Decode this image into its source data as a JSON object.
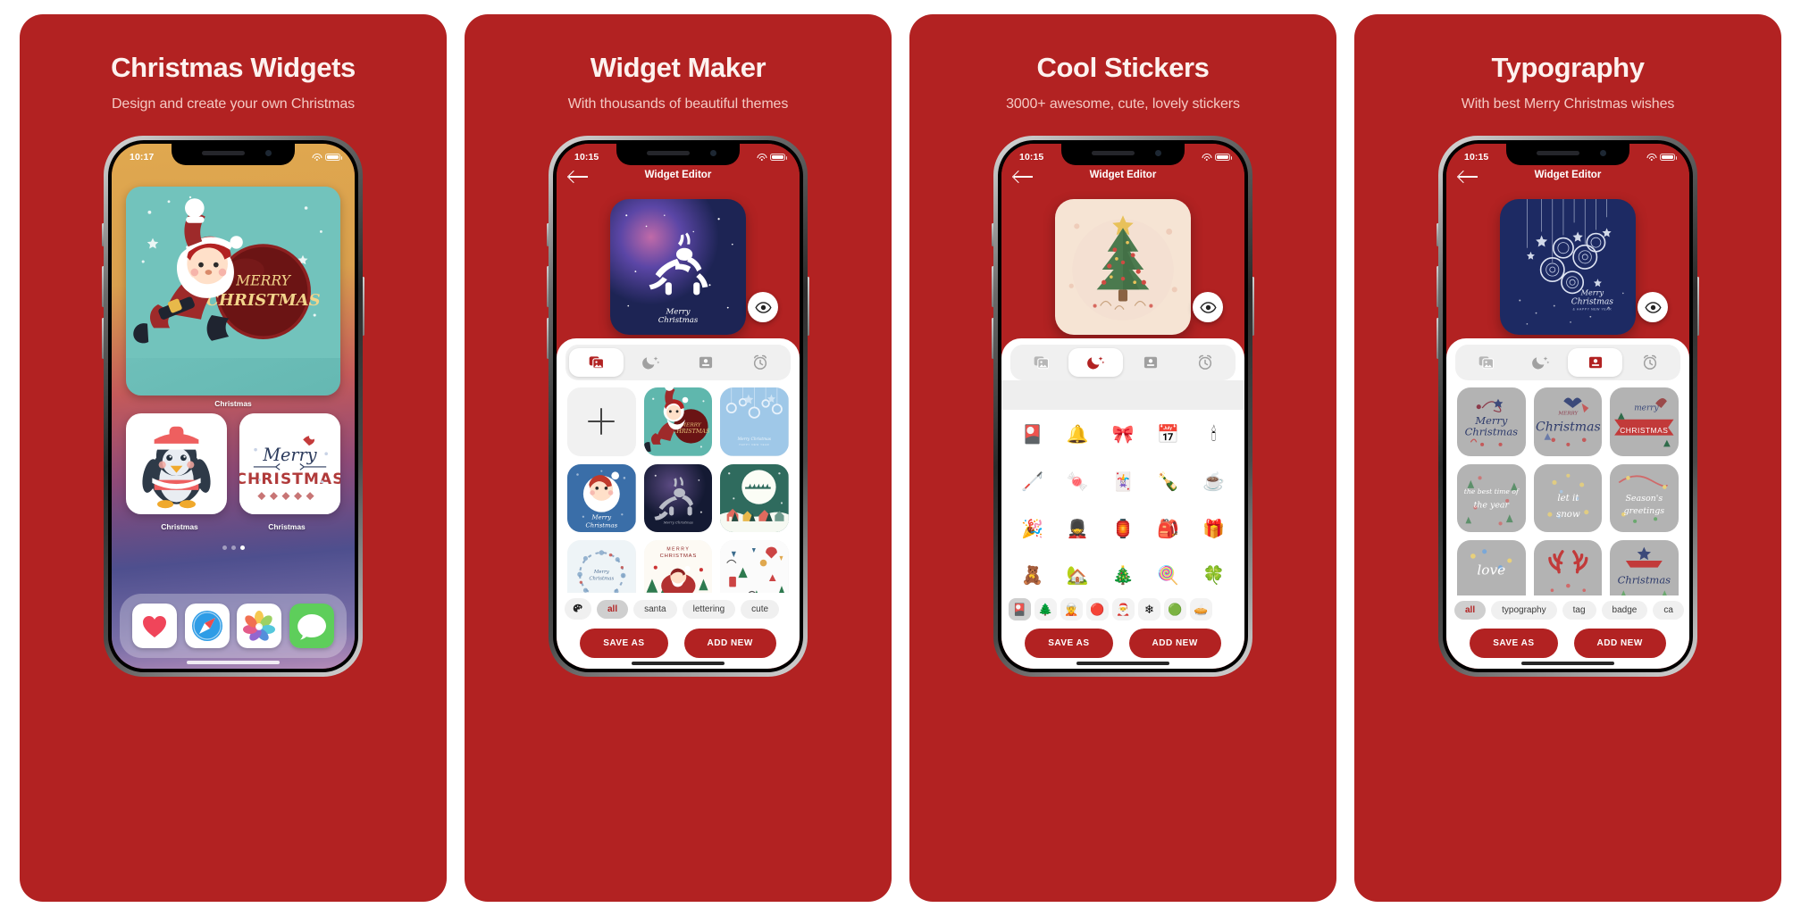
{
  "brand": {
    "red": "#b22222",
    "white": "#ffffff",
    "subtitle_color": "#f4c9c3"
  },
  "panels": [
    {
      "id": "christmas-widgets",
      "title": "Christmas Widgets",
      "subtitle": "Design and create your own Christmas",
      "screen_type": "home",
      "status_bar": {
        "time": "10:17",
        "wifi": "wifi-icon",
        "battery": "battery-icon"
      },
      "home": {
        "large_widget": {
          "caption": "Christmas",
          "art": "santa-merry-christmas"
        },
        "small_widgets": [
          {
            "caption": "Christmas",
            "art": "penguin"
          },
          {
            "caption": "Christmas",
            "art": "merry-christmas-lettering"
          }
        ],
        "page_dots": {
          "count": 3,
          "active_index": 2
        },
        "dock": [
          {
            "name": "health-app-icon",
            "label": "Health"
          },
          {
            "name": "safari-app-icon",
            "label": "Safari"
          },
          {
            "name": "photos-app-icon",
            "label": "Photos"
          },
          {
            "name": "messages-app-icon",
            "label": "Messages"
          }
        ]
      }
    },
    {
      "id": "widget-maker",
      "title": "Widget Maker",
      "subtitle": "With thousands of beautiful themes",
      "screen_type": "editor",
      "status_bar": {
        "time": "10:15",
        "wifi": "wifi-icon",
        "battery": "battery-icon"
      },
      "nav": {
        "back": "back-arrow-icon",
        "title": "Widget Editor"
      },
      "preview": {
        "art": "reindeer-galaxy",
        "caption": "Merry Christmas",
        "eye_button": "eye-icon"
      },
      "tabs": [
        {
          "name": "tab-backgrounds",
          "icon": "photos-stack-icon",
          "active": true
        },
        {
          "name": "tab-night",
          "icon": "moon-stars-icon",
          "active": false
        },
        {
          "name": "tab-card",
          "icon": "card-icon",
          "active": false
        },
        {
          "name": "tab-alarm",
          "icon": "alarm-clock-icon",
          "active": false
        }
      ],
      "grid_type": "themes",
      "themes": [
        {
          "label": "Add new",
          "art": "plus"
        },
        {
          "label": "Santa Merry Christmas",
          "art": "santa-teal"
        },
        {
          "label": "Blue baubles",
          "art": "blue-baubles"
        },
        {
          "label": "Santa Merry Christmas blue",
          "art": "santa-blue"
        },
        {
          "label": "Reindeer night",
          "art": "reindeer-dark"
        },
        {
          "label": "Sleigh moon village",
          "art": "sleigh-village"
        },
        {
          "label": "Merry Christmas wreath",
          "art": "wreath-light"
        },
        {
          "label": "Merry Christmas red",
          "art": "santa-sleigh-red"
        },
        {
          "label": "Winter doodles",
          "art": "doodles"
        }
      ],
      "filters": [
        {
          "label": "palette-icon",
          "type": "icon",
          "active": false
        },
        {
          "label": "all",
          "type": "text",
          "active": true
        },
        {
          "label": "santa",
          "type": "text",
          "active": false
        },
        {
          "label": "lettering",
          "type": "text",
          "active": false
        },
        {
          "label": "cute",
          "type": "text",
          "active": false
        }
      ],
      "actions": {
        "save": "SAVE AS",
        "add": "ADD NEW"
      }
    },
    {
      "id": "cool-stickers",
      "title": "Cool Stickers",
      "subtitle": "3000+ awesome, cute, lovely stickers",
      "screen_type": "editor",
      "status_bar": {
        "time": "10:15",
        "wifi": "wifi-icon",
        "battery": "battery-icon"
      },
      "nav": {
        "back": "back-arrow-icon",
        "title": "Widget Editor"
      },
      "preview": {
        "art": "christmas-tree-cream",
        "eye_button": "eye-icon"
      },
      "tabs": [
        {
          "name": "tab-backgrounds",
          "icon": "photos-stack-icon",
          "active": false
        },
        {
          "name": "tab-night",
          "icon": "moon-stars-icon",
          "active": true
        },
        {
          "name": "tab-card",
          "icon": "card-icon",
          "active": false
        },
        {
          "name": "tab-alarm",
          "icon": "alarm-clock-icon",
          "active": false
        }
      ],
      "grid_type": "stickers",
      "stickers": [
        "ornament-ball",
        "christmas-bell",
        "red-bow",
        "calendar-25",
        "candle",
        "candy-cane",
        "christmas-cracker",
        "greeting-card",
        "champagne-glasses",
        "hot-cocoa-mug",
        "party-popper",
        "nutcrackers",
        "fireplace",
        "gift-sack",
        "gift-box",
        "gingerbread-man",
        "snow-house-tree",
        "snowy-tree",
        "lollipop-candy",
        "holly-wreath"
      ],
      "categories": [
        {
          "name": "cat-ornament",
          "icon": "ornament",
          "active": true
        },
        {
          "name": "cat-tree",
          "icon": "tree",
          "active": false
        },
        {
          "name": "cat-elf",
          "icon": "elf",
          "active": false
        },
        {
          "name": "cat-bauble",
          "icon": "bauble",
          "active": false
        },
        {
          "name": "cat-santa",
          "icon": "santa",
          "active": false
        },
        {
          "name": "cat-snowflake",
          "icon": "snowflake",
          "active": false
        },
        {
          "name": "cat-wreath",
          "icon": "wreath",
          "active": false
        },
        {
          "name": "cat-more",
          "icon": "more",
          "active": false
        }
      ],
      "actions": {
        "save": "SAVE AS",
        "add": "ADD NEW"
      }
    },
    {
      "id": "typography",
      "title": "Typography",
      "subtitle": "With best Merry Christmas wishes",
      "screen_type": "editor",
      "status_bar": {
        "time": "10:15",
        "wifi": "wifi-icon",
        "battery": "battery-icon"
      },
      "nav": {
        "back": "back-arrow-icon",
        "title": "Widget Editor"
      },
      "preview": {
        "art": "navy-baubles",
        "caption": "Merry Christmas",
        "caption_sub": "& HAPPY NEW YEAR",
        "eye_button": "eye-icon"
      },
      "tabs": [
        {
          "name": "tab-backgrounds",
          "icon": "photos-stack-icon",
          "active": false
        },
        {
          "name": "tab-night",
          "icon": "moon-stars-icon",
          "active": false
        },
        {
          "name": "tab-card",
          "icon": "card-icon",
          "active": true
        },
        {
          "name": "tab-alarm",
          "icon": "alarm-clock-icon",
          "active": false
        }
      ],
      "grid_type": "typography",
      "typography": [
        {
          "line1": "Merry",
          "line2": "Christmas",
          "style": "navy-script"
        },
        {
          "line1": "MERRY",
          "line2": "Christmas",
          "style": "navy-script"
        },
        {
          "line1": "merry",
          "line2": "CHRISTMAS",
          "style": "red-banner"
        },
        {
          "line1": "the best time of",
          "line2": "the year",
          "style": "white-script"
        },
        {
          "line1": "let it",
          "line2": "snow",
          "style": "white-script"
        },
        {
          "line1": "Season's",
          "line2": "greetings",
          "style": "white-script"
        },
        {
          "line1": "love",
          "line2": "",
          "style": "white-script"
        },
        {
          "line1": "",
          "line2": "",
          "style": "red-antlers"
        },
        {
          "line1": "Christmas",
          "line2": "",
          "style": "navy-script"
        }
      ],
      "filters": [
        {
          "label": "all",
          "type": "text",
          "active": true
        },
        {
          "label": "typography",
          "type": "text",
          "active": false
        },
        {
          "label": "tag",
          "type": "text",
          "active": false
        },
        {
          "label": "badge",
          "type": "text",
          "active": false
        },
        {
          "label": "ca",
          "type": "text",
          "active": false
        }
      ],
      "actions": {
        "save": "SAVE AS",
        "add": "ADD NEW"
      }
    }
  ]
}
